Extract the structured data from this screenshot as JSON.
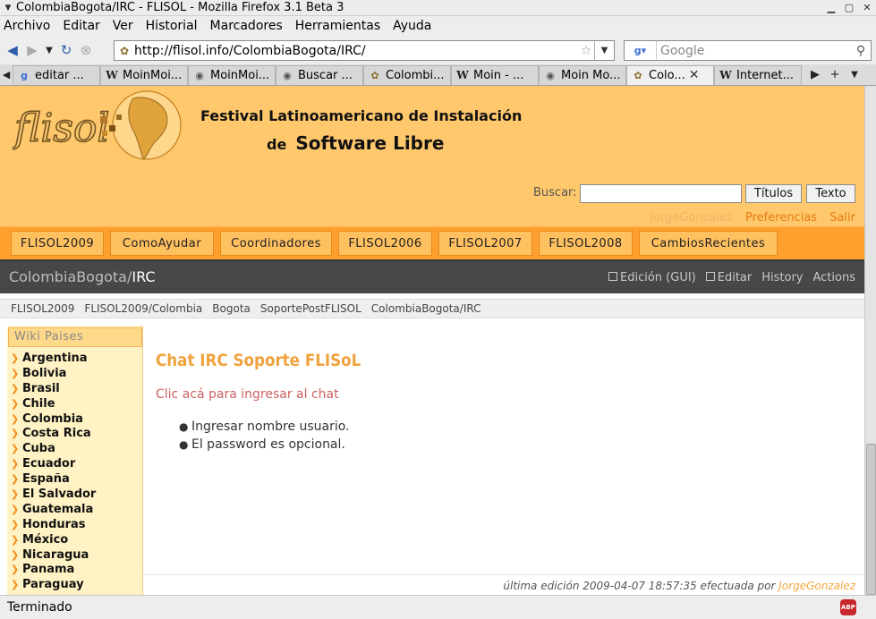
{
  "window": {
    "title": "ColombiaBogota/IRC - FLISOL - Mozilla Firefox 3.1 Beta 3"
  },
  "menubar": [
    "Archivo",
    "Editar",
    "Ver",
    "Historial",
    "Marcadores",
    "Herramientas",
    "Ayuda"
  ],
  "navbar": {
    "url": "http://flisol.info/ColombiaBogota/IRC/",
    "search_placeholder": "Google"
  },
  "tabs": [
    {
      "label": "editar ...",
      "icon": "google-icon",
      "active": false
    },
    {
      "label": "MoinMoi...",
      "icon": "wikipedia-icon",
      "active": false
    },
    {
      "label": "MoinMoi...",
      "icon": "moin-icon",
      "active": false
    },
    {
      "label": "Buscar ...",
      "icon": "moin-icon",
      "active": false
    },
    {
      "label": "Colombi...",
      "icon": "flisol-icon",
      "active": false
    },
    {
      "label": "Moin - ...",
      "icon": "wikipedia-icon",
      "active": false
    },
    {
      "label": "Moin Mo...",
      "icon": "moin-icon",
      "active": false
    },
    {
      "label": "Colo...",
      "icon": "flisol-icon",
      "active": true
    },
    {
      "label": "Internet...",
      "icon": "wikipedia-icon",
      "active": false
    }
  ],
  "site": {
    "logo_text": "flisol",
    "tagline_line1": "Festival Latinoamericano de Instalación",
    "tagline_de": "de",
    "tagline_line2": "Software Libre",
    "search_label": "Buscar:",
    "btn_titulos": "Títulos",
    "btn_texto": "Texto",
    "user": "JorgeGonzalez",
    "preferences": "Preferencias",
    "logout": "Salir"
  },
  "navtabs": [
    "FLISOL2009",
    "ComoAyudar",
    "Coordinadores",
    "FLISOL2006",
    "FLISOL2007",
    "FLISOL2008",
    "CambiosRecientes"
  ],
  "pagetitle": {
    "parent": "ColombiaBogota/",
    "current": "IRC"
  },
  "actions": [
    "Edición (GUI)",
    "Editar",
    "History",
    "Actions"
  ],
  "breadcrumbs": [
    "FLISOL2009",
    "FLISOL2009/Colombia",
    "Bogota",
    "SoportePostFLISOL",
    "ColombiaBogota/IRC"
  ],
  "sidebar": {
    "heading": "Wiki Paises",
    "countries": [
      "Argentina",
      "Bolivia",
      "Brasil",
      "Chile",
      "Colombia",
      "Costa Rica",
      "Cuba",
      "Ecuador",
      "España",
      "El Salvador",
      "Guatemala",
      "Honduras",
      "México",
      "Nicaragua",
      "Panama",
      "Paraguay"
    ]
  },
  "content": {
    "heading": "Chat IRC Soporte FLISoL",
    "chat_link": "Clic acá para ingresar al chat",
    "bullets": [
      "Ingresar nombre usuario.",
      "El password es opcional."
    ],
    "last_edit": "última edición 2009-04-07 18:57:35 efectuada por",
    "last_edit_author": "JorgeGonzalez"
  },
  "status": {
    "text": "Terminado",
    "abp_label": "ABP"
  },
  "colors": {
    "header_bg": "#ffc86c",
    "navtab_bg": "#ff9f2e",
    "titlebar_bg": "#474747",
    "heading_color": "#f0a23c",
    "link_color": "#cc6060"
  }
}
